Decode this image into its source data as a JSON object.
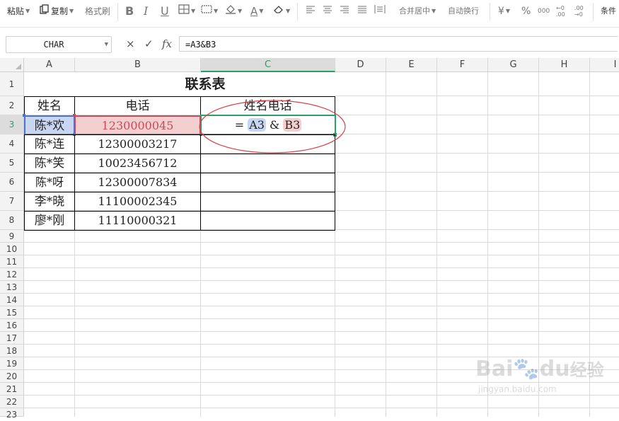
{
  "ribbon": {
    "paste": "粘贴",
    "copy": "复制",
    "format_painter": "格式刷",
    "bold": "B",
    "italic": "I",
    "underline": "U",
    "font_color_letter": "A",
    "merge_center": "合并居中",
    "wrap_text": "自动换行",
    "currency": "¥",
    "percent": "%",
    "thousands": "000",
    "inc_decimal": "←0 .00",
    "dec_decimal": ".00 →0",
    "conditional": "条件"
  },
  "formula_bar": {
    "name_box": "CHAR",
    "cancel": "×",
    "confirm": "✓",
    "fx": "fx",
    "formula": "=A3&B3"
  },
  "columns": [
    "A",
    "B",
    "C",
    "D",
    "E",
    "F",
    "G",
    "H",
    "I"
  ],
  "rows": [
    "1",
    "2",
    "3",
    "4",
    "5",
    "6",
    "7",
    "8",
    "9",
    "10",
    "11",
    "12",
    "13",
    "14",
    "15",
    "16",
    "17",
    "18",
    "19",
    "20",
    "21",
    "22",
    "23"
  ],
  "selected_cell": {
    "column": "C",
    "row": "3"
  },
  "sheet": {
    "title": "联系表",
    "headers": [
      "姓名",
      "电话",
      "姓名电话"
    ],
    "data": [
      {
        "name": "陈*欢",
        "phone": "1230000045"
      },
      {
        "name": "陈*连",
        "phone": "12300003217"
      },
      {
        "name": "陈*笑",
        "phone": "10023456712"
      },
      {
        "name": "陈*呀",
        "phone": "12300007834"
      },
      {
        "name": "李*晓",
        "phone": "11100002345"
      },
      {
        "name": "廖*刚",
        "phone": "11110000321"
      }
    ],
    "editing_formula": {
      "eq": "=",
      "ref1": "A3",
      "amp": "&",
      "ref2": "B3"
    }
  },
  "colors": {
    "ref1_highlight": "#c9d6f2",
    "ref1_border": "#4e73c9",
    "ref2_highlight": "#f3cfd0",
    "ref2_border": "#c54c5a",
    "active_border": "#2e9e68",
    "annotation_circle": "#d9434a"
  },
  "watermark": {
    "brand_latin": "Bai",
    "brand_suffix": "du",
    "brand_cn": "经验",
    "url": "jingyan.baidu.com"
  }
}
